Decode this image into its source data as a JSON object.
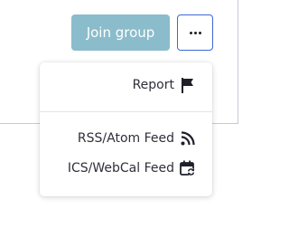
{
  "header": {
    "join_label": "Join group"
  },
  "more_button": {
    "icon": "ellipsis-icon"
  },
  "menu": {
    "items": [
      {
        "label": "Report",
        "icon": "flag-icon"
      },
      {
        "label": "RSS/Atom Feed",
        "icon": "rss-icon"
      },
      {
        "label": "ICS/WebCal Feed",
        "icon": "calendar-sync-icon"
      }
    ]
  },
  "colors": {
    "join_button": "#8bbccb",
    "more_button_border": "#3c68d6",
    "text": "#2f2f3a"
  }
}
